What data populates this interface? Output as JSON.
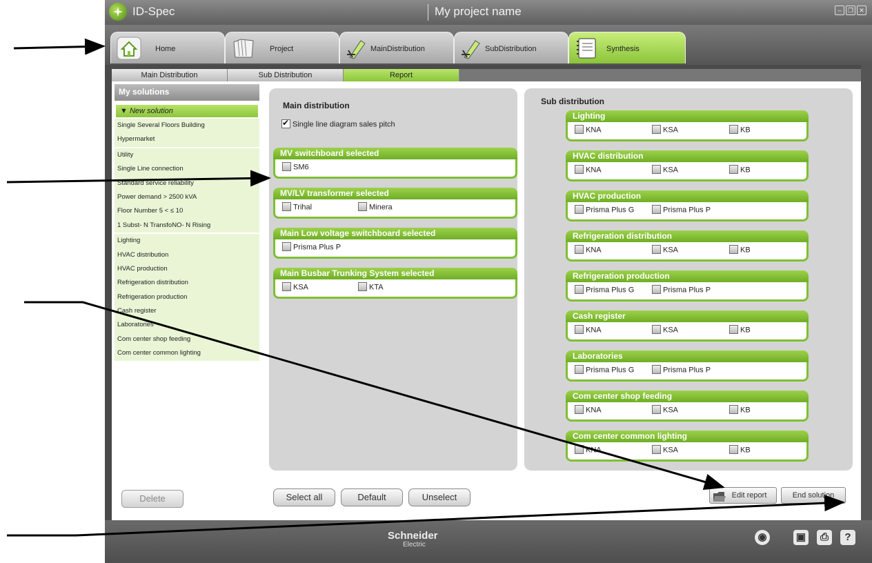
{
  "window": {
    "app_title": "ID-Spec",
    "project_name": "My project name"
  },
  "main_tabs": [
    {
      "label": "Home",
      "icon": "house-icon"
    },
    {
      "label": "Project",
      "icon": "folder-icon"
    },
    {
      "label": "MainDistribution",
      "icon": "tool-icon"
    },
    {
      "label": "SubDistribution",
      "icon": "tool-icon"
    },
    {
      "label": "Synthesis",
      "icon": "notebook-icon",
      "active": true
    }
  ],
  "sub_tabs": [
    {
      "label": "Main Distribution"
    },
    {
      "label": "Sub Distribution"
    },
    {
      "label": "Report",
      "active": true
    }
  ],
  "sidebar": {
    "title": "My solutions",
    "new_solution": "▼ New solution",
    "items": [
      "Single Several Floors Building",
      "Hypermarket",
      "Utility",
      "Single Line connection",
      "Standard service reliability",
      "Power demand > 2500 kVA",
      "Floor Number 5 <  ≤ 10",
      "1 Subst- N TransfoNO- N Rising",
      "Lighting",
      "HVAC distribution",
      "HVAC production",
      "Refrigeration distribution",
      "Refrigeration production",
      "Cash register",
      "Laboratories",
      "Com center shop feeding",
      "Com center common lighting"
    ],
    "delete_label": "Delete"
  },
  "main_distribution": {
    "heading": "Main distribution",
    "sales_pitch": "Single line diagram sales pitch",
    "groups": [
      {
        "title": "MV switchboard selected",
        "options": [
          "SM6"
        ]
      },
      {
        "title": "MV/LV transformer selected",
        "options": [
          "Trihal",
          "Minera"
        ]
      },
      {
        "title": "Main Low voltage switchboard selected",
        "options": [
          "Prisma Plus P"
        ]
      },
      {
        "title": "Main Busbar Trunking System selected",
        "options": [
          "KSA",
          "KTA"
        ]
      }
    ]
  },
  "sub_distribution": {
    "heading": "Sub distribution",
    "groups": [
      {
        "title": "Lighting",
        "options": [
          "KNA",
          "KSA",
          "KB"
        ]
      },
      {
        "title": "HVAC distribution",
        "options": [
          "KNA",
          "KSA",
          "KB"
        ]
      },
      {
        "title": "HVAC production",
        "options": [
          "Prisma Plus G",
          "Prisma Plus P"
        ]
      },
      {
        "title": "Refrigeration distribution",
        "options": [
          "KNA",
          "KSA",
          "KB"
        ]
      },
      {
        "title": "Refrigeration production",
        "options": [
          "Prisma Plus G",
          "Prisma Plus P"
        ]
      },
      {
        "title": "Cash register",
        "options": [
          "KNA",
          "KSA",
          "KB"
        ]
      },
      {
        "title": "Laboratories",
        "options": [
          "Prisma Plus G",
          "Prisma Plus P"
        ]
      },
      {
        "title": "Com center shop feeding",
        "options": [
          "KNA",
          "KSA",
          "KB"
        ]
      },
      {
        "title": "Com center common lighting",
        "options": [
          "KNA",
          "KSA",
          "KB"
        ]
      }
    ]
  },
  "buttons": {
    "select_all": "Select all",
    "default": "Default",
    "unselect": "Unselect",
    "edit_report": "Edit report",
    "end_solution": "End solution"
  },
  "footer": {
    "brand": "Schneider",
    "brand_sub": "Electric"
  },
  "colors": {
    "accent_green": "#8dc63f",
    "chrome_gray": "#5f5f5f"
  }
}
